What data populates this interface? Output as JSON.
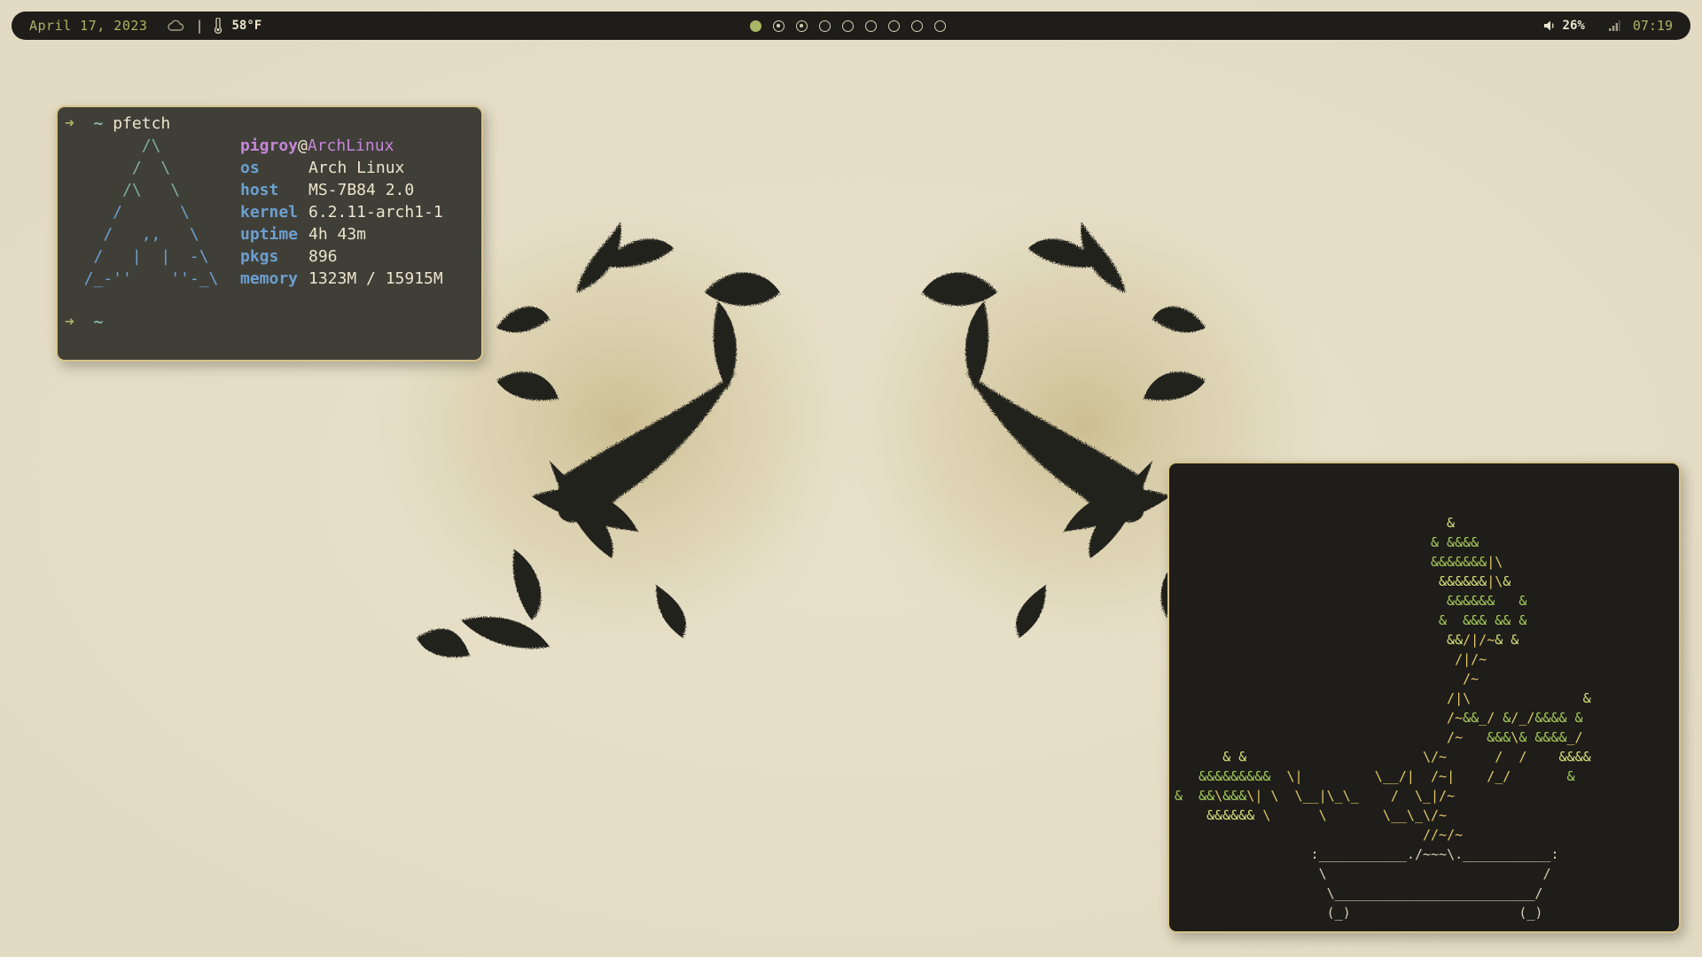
{
  "topbar": {
    "date": "April 17, 2023",
    "weather_icon": "cloud-icon",
    "separator": "|",
    "thermometer_icon": "thermometer-icon",
    "temperature": "58°F",
    "workspaces": [
      {
        "state": "active"
      },
      {
        "state": "occupied"
      },
      {
        "state": "occupied"
      },
      {
        "state": "empty"
      },
      {
        "state": "empty"
      },
      {
        "state": "empty"
      },
      {
        "state": "empty"
      },
      {
        "state": "empty"
      },
      {
        "state": "empty"
      }
    ],
    "volume_icon": "speaker-icon",
    "volume": "26%",
    "network_icon": "signal-icon",
    "time": "07:19"
  },
  "pfetch_terminal": {
    "prompt_arrow": "➜",
    "prompt_dir": "~",
    "command": "pfetch",
    "logo_lines": [
      "        /\\",
      "       /  \\",
      "      /\\   \\",
      "     /      \\",
      "    /   ,,   \\",
      "   /   |  |  -\\",
      "  /_-''    ''-_\\"
    ],
    "user": "pigroy",
    "at": "@",
    "host": "ArchLinux",
    "info": [
      {
        "key": "os",
        "value": "Arch Linux"
      },
      {
        "key": "host",
        "value": "MS-7B84 2.0"
      },
      {
        "key": "kernel",
        "value": "6.2.11-arch1-1"
      },
      {
        "key": "uptime",
        "value": "4h 43m"
      },
      {
        "key": "pkgs",
        "value": "896"
      },
      {
        "key": "memory",
        "value": "1323M / 15915M"
      }
    ],
    "second_prompt_arrow": "➜",
    "second_prompt_dir": "~"
  },
  "bonsai_terminal": {
    "lines": [
      "                                  &",
      "                                & &&&&",
      "                                &&&&&&&|\\",
      "                                 &&&&&&|\\&",
      "                                  &&&&&&   &",
      "                                 &  &&& && &",
      "                                  &&/|/~& &",
      "                                   /|/~",
      "                                    /~",
      "                                  /|\\              &",
      "                                  /~&&_/ &/_/&&&& &",
      "                                  /~   &&&\\& &&&&_/",
      "      & &                      \\/~      /  /    &&&&",
      "   &&&&&&&&&  \\|         \\__/|  /~|    /_/       &",
      "&  &&\\&&&\\| \\  \\__|\\_\\_    /  \\_|/~",
      "    &&&&&& \\      \\       \\__\\_\\/~",
      "                               //~/~",
      "                 :___________./~~~\\.___________:",
      "                  \\                           /",
      "                   \\_________________________/",
      "                   (_)                     (_)"
    ]
  },
  "colors": {
    "wallpaper_bg": "#e6dfc8",
    "bar_bg": "#1e1d19",
    "accent_green": "#a9b665",
    "terminal_border": "#d8c48a",
    "pfetch_bg": "#3f3f38",
    "bonsai_bg": "#1e1d19"
  }
}
